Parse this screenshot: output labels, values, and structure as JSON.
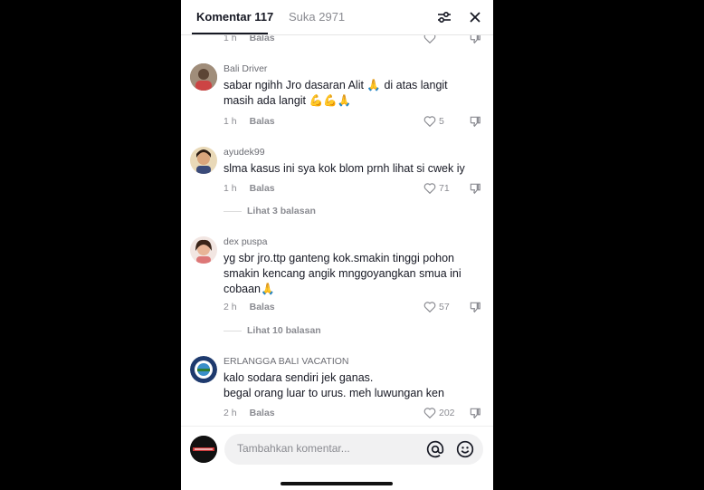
{
  "tabs": {
    "comments_label": "Komentar 117",
    "likes_label": "Suka 2971"
  },
  "partial_top": {
    "time": "1 h",
    "reply": "Balas"
  },
  "comments": [
    {
      "username": "Bali Driver",
      "text_line1": "sabar ngihh Jro dasaran Alit 🙏 di atas langit",
      "text_line2": "masih ada langit 💪💪🙏",
      "time": "1 h",
      "reply": "Balas",
      "likes": "5"
    },
    {
      "username": "ayudek99",
      "text_line1": "slma kasus ini sya kok blom prnh lihat si cwek iy",
      "time": "1 h",
      "reply": "Balas",
      "likes": "71",
      "view_replies": "Lihat 3 balasan"
    },
    {
      "username": "dex puspa",
      "text_line1": "yg sbr jro.ttp ganteng kok.smakin tinggi pohon",
      "text_line2": "smakin kencang angik mnggoyangkan smua ini",
      "text_line3": "cobaan🙏",
      "time": "2 h",
      "reply": "Balas",
      "likes": "57",
      "view_replies": "Lihat 10 balasan"
    },
    {
      "username": "ERLANGGA BALI VACATION",
      "text_line1": "kalo sodara sendiri jek ganas.",
      "text_line2": "begal orang luar to urus. meh luwungan ken",
      "time": "2 h",
      "reply": "Balas",
      "likes": "202"
    }
  ],
  "composer": {
    "placeholder": "Tambahkan komentar..."
  },
  "icons": [
    "filter-icon",
    "close-icon",
    "heart-icon",
    "dislike-icon",
    "mention-icon",
    "emoji-icon"
  ],
  "colors": {
    "text": "#161823",
    "muted": "#8a8b91",
    "background": "#ffffff"
  }
}
